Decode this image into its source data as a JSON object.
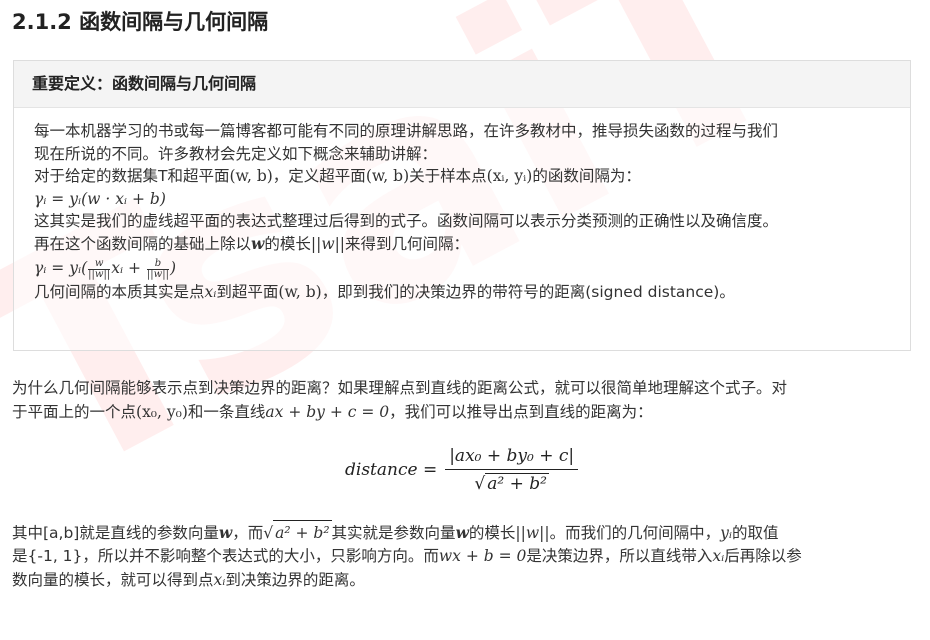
{
  "heading": "2.1.2 函数间隔与几何间隔",
  "box": {
    "title": "重要定义：函数间隔与几何间隔",
    "line1": "每一本机器学习的书或每一篇博客都可能有不同的原理讲解思路，在许多教材中，推导损失函数的过程与我们",
    "line2": "现在所说的不同。许多教材会先定义如下概念来辅助讲解：",
    "line3_a": "对于给定的数据集T和超平面",
    "line3_b": "(w, b)",
    "line3_c": "，定义超平面",
    "line3_d": "(w, b)",
    "line3_e": "关于样本点",
    "line3_f": "(xᵢ, yᵢ)",
    "line3_g": "的函数间隔为：",
    "formula1": "γᵢ = yᵢ(w · xᵢ + b)",
    "line5": "这其实是我们的虚线超平面的表达式整理过后得到的式子。函数间隔可以表示分类预测的正确性以及确信度。",
    "line6_a": "再在这个函数间隔的基础上除以",
    "line6_b": "w",
    "line6_c": "的模长",
    "line6_d": "||w||",
    "line6_e": "来得到几何间隔：",
    "formula2_a": "γᵢ = yᵢ(",
    "formula2_f1_num": "w",
    "formula2_f1_den": "||w||",
    "formula2_b": "xᵢ +",
    "formula2_f2_num": "b",
    "formula2_f2_den": "||w||",
    "formula2_c": ")",
    "line8_a": "几何间隔的本质其实是点",
    "line8_b": "xᵢ",
    "line8_c": "到超平面",
    "line8_d": "(w, b)",
    "line8_e": "，即到我们的决策边界的带符号的距离(signed distance)。"
  },
  "para1": {
    "line1": "为什么几何间隔能够表示点到决策边界的距离？如果理解点到直线的距离公式，就可以很简单地理解这个式子。对",
    "line2_a": "于平面上的一个点",
    "line2_b": "(x₀, y₀)",
    "line2_c": "和一条直线",
    "line2_d": "ax + by + c = 0",
    "line2_e": "，我们可以推导出点到直线的距离为："
  },
  "formula3": {
    "lhs": "distance =",
    "num": "|ax₀ + by₀ + c|",
    "den": "a² + b²"
  },
  "para2": {
    "line1_a": "其中[a,b]就是直线的参数向量",
    "line1_b": "w",
    "line1_c": "，而",
    "line1_d": "a² + b²",
    "line1_e": "其实就是参数向量",
    "line1_f": "w",
    "line1_g": "的模长",
    "line1_h": "||w||",
    "line1_i": "。而我们的几何间隔中，",
    "line1_j": "yᵢ",
    "line1_k": "的取值",
    "line2_a": "是{-1, 1}，所以并不影响整个表达式的大小，只影响方向。而",
    "line2_b": "wx + b = 0",
    "line2_c": "是决策边界，所以直线带入",
    "line2_d": "xᵢ",
    "line2_e": "后再除以参",
    "line3_a": "数向量的模长，就可以得到点",
    "line3_b": "xᵢ",
    "line3_c": "到决策边界的距离。"
  },
  "watermark": "TsaiT",
  "colors": {
    "watermark": "#ff5a5a",
    "box_header_bg": "#f4f4f4",
    "box_border": "#dddddd"
  }
}
